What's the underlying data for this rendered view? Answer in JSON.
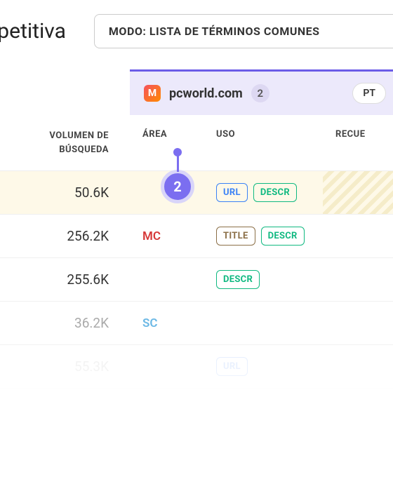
{
  "title": "mpetitiva",
  "mode_selector": "MODO: LISTA DE TÉRMINOS COMUNES",
  "domain": {
    "icon_letter": "M",
    "name": "pcworld.com",
    "count": "2",
    "pt_label": "PT"
  },
  "columns": {
    "volumen": "VOLUMEN DE BÚSQUEDA",
    "area": "ÁREA",
    "uso": "USO",
    "recue": "RECUE"
  },
  "step_number": "2",
  "rows": [
    {
      "volumen": "50.6K",
      "area": "",
      "tags": [
        "URL",
        "DESCR"
      ],
      "highlighted": true
    },
    {
      "volumen": "256.2K",
      "area": "MC",
      "tags": [
        "TITLE",
        "DESCR"
      ]
    },
    {
      "volumen": "255.6K",
      "area": "",
      "tags": [
        "DESCR"
      ]
    },
    {
      "volumen": "36.2K",
      "area": "SC",
      "tags": [],
      "dimmed": true
    },
    {
      "volumen": "55.3K",
      "area": "",
      "tags": [
        "URL"
      ],
      "faded": true
    }
  ]
}
